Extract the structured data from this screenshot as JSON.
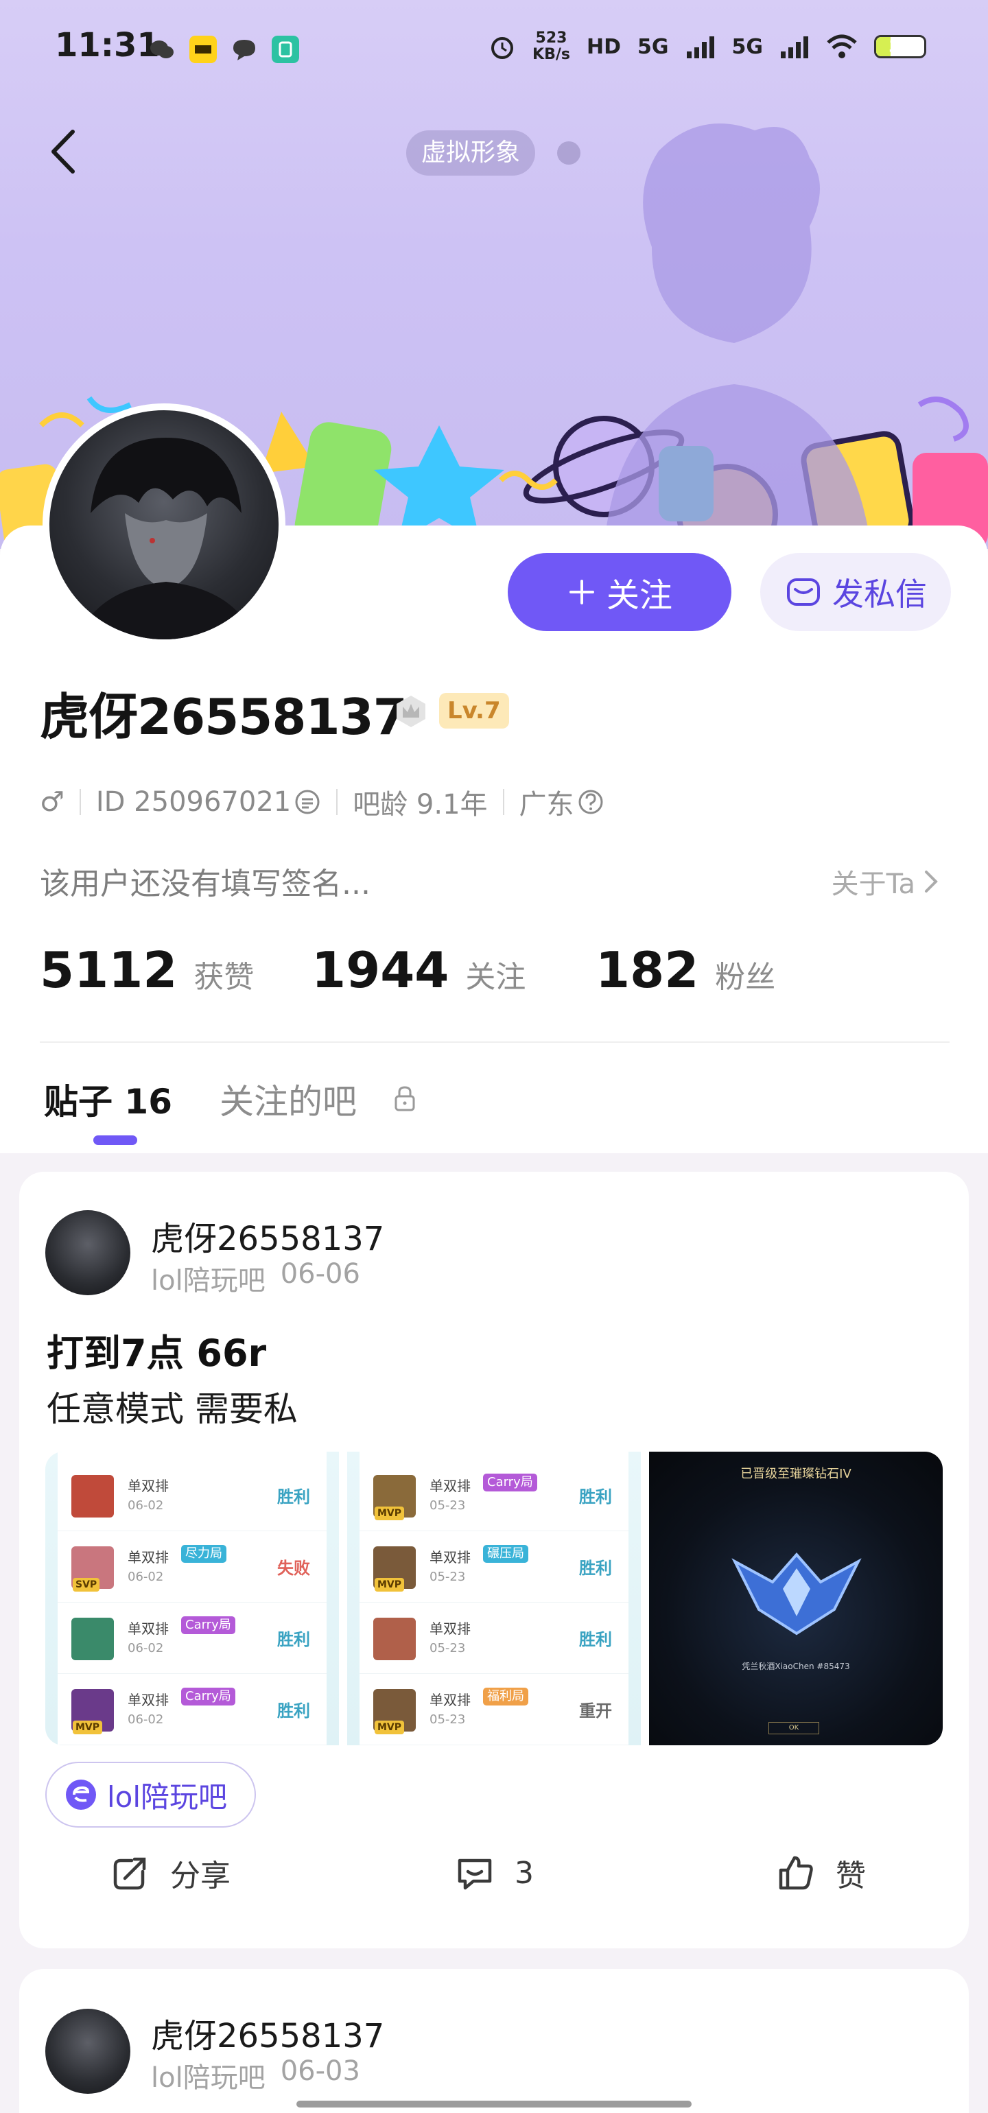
{
  "status_bar": {
    "time": "11:31",
    "net_speed_value": "523",
    "net_speed_unit": "KB/s",
    "hd": "HD",
    "sim1": "5G",
    "sim2": "5G",
    "battery": "30",
    "battery_level": 0.3
  },
  "header": {
    "avatar_tag": "虚拟形象"
  },
  "profile": {
    "username": "虎伢26558137",
    "level": "Lv.7",
    "gender_symbol": "♂",
    "user_id": "ID 250967021",
    "account_age": "吧龄 9.1年",
    "region": "广东",
    "signature": "该用户还没有填写签名...",
    "about_label": "关于Ta",
    "follow_label": "关注",
    "message_label": "发私信"
  },
  "stats": [
    {
      "value": "5112",
      "label": "获赞"
    },
    {
      "value": "1944",
      "label": "关注"
    },
    {
      "value": "182",
      "label": "粉丝"
    }
  ],
  "tabs": {
    "posts_label": "贴子 16",
    "followed_bars_label": "关注的吧"
  },
  "posts": [
    {
      "author": "虎伢26558137",
      "forum": "lol陪玩吧",
      "date": "06-06",
      "title": "打到7点 66r",
      "body": "任意模式 需要私",
      "forum_chip": "lol陪玩吧",
      "share_label": "分享",
      "comment_count": "3",
      "like_label": "赞"
    },
    {
      "author": "虎伢26558137",
      "forum": "lol陪玩吧",
      "date": "06-03"
    }
  ],
  "post_images": {
    "left_matches": [
      {
        "mode": "单双排",
        "tag": "",
        "date": "06-02",
        "result": "胜利",
        "badge": "",
        "champ_color": "#c04a3a"
      },
      {
        "mode": "单双排",
        "tag": "尽力局",
        "date": "06-02",
        "result": "失败",
        "badge": "SVP",
        "champ_color": "#c9767e"
      },
      {
        "mode": "单双排",
        "tag": "Carry局",
        "date": "06-02",
        "result": "胜利",
        "badge": "",
        "champ_color": "#3a8a6a"
      },
      {
        "mode": "单双排",
        "tag": "Carry局",
        "date": "06-02",
        "result": "胜利",
        "badge": "MVP",
        "champ_color": "#6a3a8a"
      }
    ],
    "middle_matches": [
      {
        "mode": "单双排",
        "tag": "Carry局",
        "date": "05-23",
        "result": "胜利",
        "badge": "MVP",
        "champ_color": "#8a6a3a"
      },
      {
        "mode": "单双排",
        "tag": "碾压局",
        "date": "05-23",
        "result": "胜利",
        "badge": "MVP",
        "champ_color": "#7a5a3a"
      },
      {
        "mode": "单双排",
        "tag": "",
        "date": "05-23",
        "result": "胜利",
        "badge": "",
        "champ_color": "#b0604a"
      },
      {
        "mode": "单双排",
        "tag": "福利局",
        "date": "05-23",
        "result": "重开",
        "badge": "MVP",
        "champ_color": "#7a5a3a"
      }
    ],
    "rank_title": "已晋级至璀璨钻石IV",
    "rank_player": "凭兰秋酒XiaoChen #85473",
    "rank_ok": "OK"
  },
  "colors": {
    "accent": "#7058f6",
    "win": "#3aa3c2",
    "lose": "#e0625a",
    "reopen": "#6a6a6a"
  }
}
